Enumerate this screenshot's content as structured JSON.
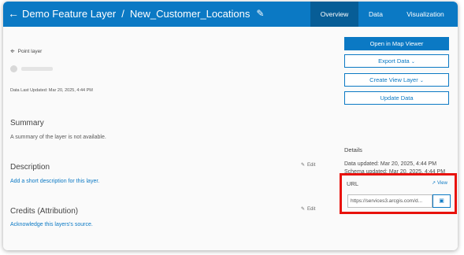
{
  "header": {
    "back_link": "Demo Feature Layer",
    "separator": "/",
    "item_title": "New_Customer_Locations",
    "tabs": [
      {
        "label": "Overview"
      },
      {
        "label": "Data"
      },
      {
        "label": "Visualization"
      }
    ]
  },
  "info": {
    "layer_type": "Point layer",
    "data_last_updated": "Data Last Updated: Mar 20, 2025, 4:44 PM"
  },
  "sections": {
    "summary": {
      "heading": "Summary",
      "text": "A summary of the layer is not available."
    },
    "description": {
      "heading": "Description",
      "edit": "Edit",
      "link": "Add a short description for this layer."
    },
    "credits": {
      "heading": "Credits (Attribution)",
      "edit": "Edit",
      "link": "Acknowledge this layers's source."
    }
  },
  "actions": {
    "open_map_viewer": "Open in Map Viewer",
    "export_data": "Export Data",
    "create_view_layer": "Create View Layer",
    "update_data": "Update Data"
  },
  "details": {
    "heading": "Details",
    "data_updated": "Data updated: Mar 20, 2025, 4:44 PM",
    "schema_updated": "Schema updated: Mar 20, 2025, 4:44 PM"
  },
  "url": {
    "label": "URL",
    "view": "View",
    "value": "https://services3.arcgis.com/d..."
  },
  "colors": {
    "brand_blue": "#0b79c4",
    "active_tab": "#075d96",
    "highlight_red": "#e8120c"
  }
}
